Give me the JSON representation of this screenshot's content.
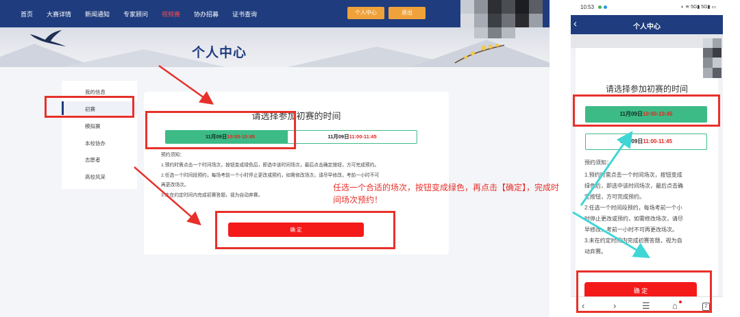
{
  "desktop": {
    "nav": [
      {
        "label": "首页",
        "active": false
      },
      {
        "label": "大赛详情",
        "active": false
      },
      {
        "label": "新闻通知",
        "active": false
      },
      {
        "label": "专家顾问",
        "active": false
      },
      {
        "label": "视频赛",
        "active": true
      },
      {
        "label": "协办招募",
        "active": false
      },
      {
        "label": "证书查询",
        "active": false
      }
    ],
    "user_center_btn": "个人中心",
    "logout_btn": "退出",
    "banner_title": "个人中心",
    "sidebar": [
      {
        "label": "我的信息",
        "active": false
      },
      {
        "label": "初赛",
        "active": true
      },
      {
        "label": "模拟赛",
        "active": false
      },
      {
        "label": "本校协办",
        "active": false
      },
      {
        "label": "志愿者",
        "active": false
      },
      {
        "label": "高校风采",
        "active": false
      }
    ],
    "content_title": "请选择参加初赛的时间",
    "slots": [
      {
        "date": "11月09日",
        "time": "10:00-10:45",
        "selected": true
      },
      {
        "date": "11月09日",
        "time": "11:00-11:45",
        "selected": false
      }
    ],
    "notes_title": "预约须知：",
    "notes": [
      "1.预约时需点击一个时间场次，按钮变成绿色后，即选中该时间场次，最后点击确定按钮，方可完成预约。",
      "2.任选一个时间段预约，每场考前一个小时停止更改或预约，如需修改场次，请尽早修改，考前一小时不可",
      "再更改场次。",
      "3.未在约定时间内完成初赛答题，视为自动弃赛。"
    ],
    "confirm_btn": "确 定",
    "instruction": "任选一个合适的场次，按钮变成绿色，再点击【确定】，完成时间场次预约！"
  },
  "phone": {
    "status_time": "10:53",
    "status_icons": "◐ ≋ 5G▮ 5G▮ ▭",
    "back_icon": "‹",
    "header_title": "个人中心",
    "question": "请选择参加初赛的时间",
    "slots": [
      {
        "date": "11月09日",
        "time": "10:00-10:45",
        "selected": true
      },
      {
        "date": "11月09日",
        "time": "11:00-11:45",
        "selected": false
      }
    ],
    "notes_title": "预约须知：",
    "notes": [
      "1.预约时需点击一个时间场次，按钮变成",
      "绿色后，即选中该时间场次，最后点击确",
      "定按钮，方可完成预约。",
      "2.任选一个时间段预约，每场考前一个小",
      "时停止更改或预约，如需修改场次，请尽",
      "早修改，考前一小时不可再更改场次。",
      "3.未在约定时间内完成初赛答题，视为自",
      "动弃赛。"
    ],
    "confirm_btn": "确 定",
    "navbar": {
      "back": "‹",
      "forward": "›",
      "menu": "☰",
      "home": "⌂",
      "tabs_count": "2"
    }
  },
  "colors": {
    "nav_blue": "#1e3c7e",
    "slot_green": "#3dbb87",
    "confirm_red": "#f41a1a",
    "annotation_red": "#e8302a",
    "arrow_teal": "#3fd6d6",
    "nav_button_orange": "#f0a23a"
  }
}
